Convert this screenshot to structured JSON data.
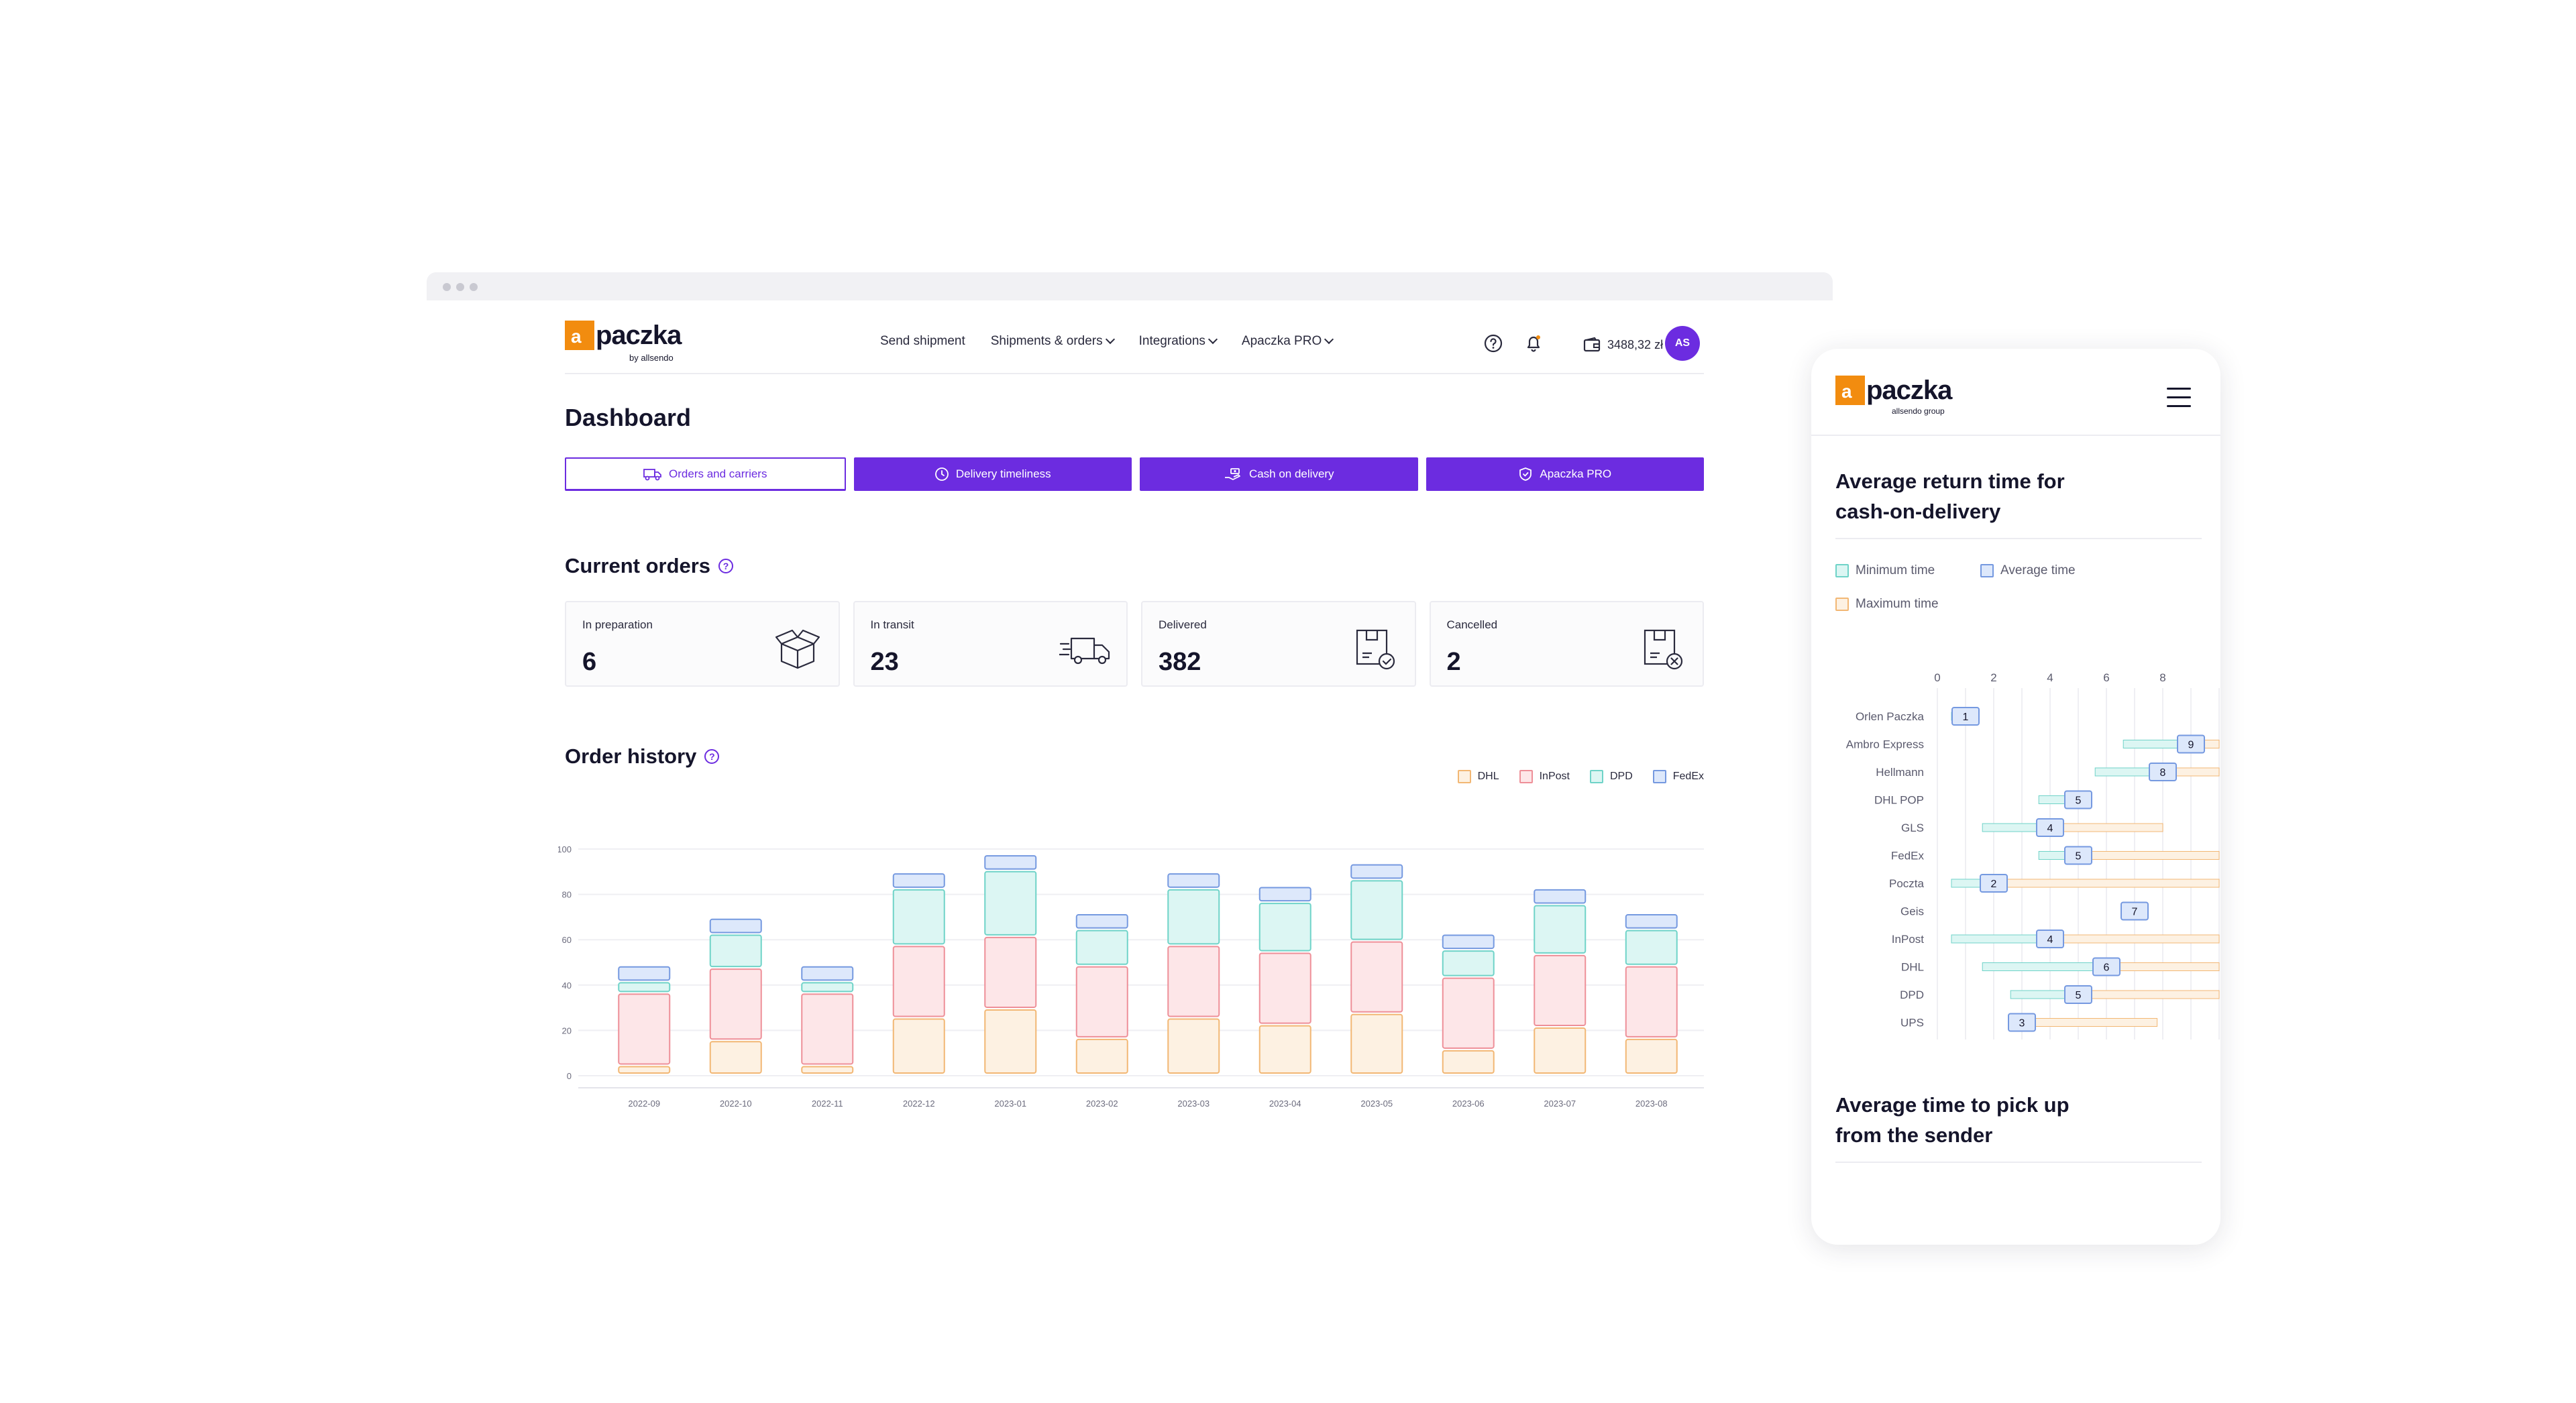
{
  "brand": {
    "logo_mark": "a",
    "logo_word": "paczka",
    "desktop_sub": "by allsendo",
    "mobile_sub": "allsendo group",
    "orange": "#f28c0f",
    "purple": "#6c2ce0"
  },
  "nav": {
    "items": [
      {
        "label": "Send shipment",
        "dropdown": false
      },
      {
        "label": "Shipments & orders",
        "dropdown": true
      },
      {
        "label": "Integrations",
        "dropdown": true
      },
      {
        "label": "Apaczka PRO",
        "dropdown": true
      }
    ],
    "help_icon": "help-circle-icon",
    "notification_icon": "bell-icon",
    "wallet_icon": "wallet-icon",
    "balance": "3488,32 zł",
    "avatar_initials": "AS"
  },
  "page": {
    "title": "Dashboard"
  },
  "tabs": [
    {
      "label": "Orders and carriers",
      "icon": "truck-icon",
      "active": true
    },
    {
      "label": "Delivery timeliness",
      "icon": "clock-icon",
      "active": false
    },
    {
      "label": "Cash on delivery",
      "icon": "hand-cash-icon",
      "active": false
    },
    {
      "label": "Apaczka PRO",
      "icon": "shield-icon",
      "active": false
    }
  ],
  "current_orders": {
    "title": "Current orders",
    "help_mark": "?",
    "cards": [
      {
        "label": "In preparation",
        "value": "6",
        "icon": "open-box-icon"
      },
      {
        "label": "In transit",
        "value": "23",
        "icon": "delivery-truck-icon"
      },
      {
        "label": "Delivered",
        "value": "382",
        "icon": "box-check-icon"
      },
      {
        "label": "Cancelled",
        "value": "2",
        "icon": "box-cancel-icon"
      }
    ]
  },
  "order_history": {
    "title": "Order history",
    "help_mark": "?",
    "legend": [
      {
        "name": "DHL",
        "fill": "#fdf1e2",
        "stroke": "#f2b774"
      },
      {
        "name": "InPost",
        "fill": "#fde6e8",
        "stroke": "#ee8f98"
      },
      {
        "name": "DPD",
        "fill": "#dcf6f3",
        "stroke": "#6fd3c8"
      },
      {
        "name": "FedEx",
        "fill": "#dde8fb",
        "stroke": "#7599e0"
      }
    ]
  },
  "chart_data": [
    {
      "type": "bar",
      "stacked": true,
      "title": "Order history",
      "categories": [
        "2022-09",
        "2022-10",
        "2022-11",
        "2022-12",
        "2023-01",
        "2023-02",
        "2023-03",
        "2023-04",
        "2023-05",
        "2023-06",
        "2023-07",
        "2023-08"
      ],
      "series": [
        {
          "name": "DHL",
          "values": [
            4,
            15,
            4,
            25,
            29,
            16,
            25,
            22,
            27,
            11,
            21,
            16
          ]
        },
        {
          "name": "InPost",
          "values": [
            32,
            32,
            32,
            32,
            32,
            32,
            32,
            32,
            32,
            32,
            32,
            32
          ]
        },
        {
          "name": "DPD",
          "values": [
            5,
            15,
            5,
            25,
            29,
            16,
            25,
            22,
            27,
            12,
            22,
            16
          ]
        },
        {
          "name": "FedEx",
          "values": [
            7,
            7,
            7,
            7,
            7,
            7,
            7,
            7,
            7,
            7,
            7,
            7
          ]
        }
      ],
      "ylim": [
        0,
        100
      ],
      "yticks": [
        0,
        20,
        40,
        60,
        80,
        100
      ],
      "grid": true,
      "legend_position": "top-right"
    },
    {
      "type": "bar",
      "orientation": "horizontal",
      "title": "Average return time for cash-on-delivery",
      "categories": [
        "Orlen Paczka",
        "Ambro Express",
        "Hellmann",
        "DHL POP",
        "GLS",
        "FedEx",
        "Poczta",
        "Geis",
        "InPost",
        "DHL",
        "DPD",
        "UPS"
      ],
      "series": [
        {
          "name": "Minimum time",
          "fill": "#dcf6f3",
          "stroke": "#6fd3c8",
          "values": [
            0.5,
            6.6,
            5.6,
            3.6,
            1.6,
            3.6,
            0.5,
            6.6,
            0.5,
            1.6,
            2.6,
            2.6
          ]
        },
        {
          "name": "Average time",
          "fill": "#dde8fb",
          "stroke": "#7599e0",
          "values": [
            1,
            9,
            8,
            5,
            4,
            5,
            2,
            7,
            4,
            6,
            5,
            3
          ]
        },
        {
          "name": "Maximum time",
          "fill": "#fdf1e2",
          "stroke": "#f2b774",
          "values": [
            null,
            10,
            10,
            null,
            8,
            10,
            10,
            null,
            10,
            10,
            10,
            7.8
          ]
        }
      ],
      "xticks": [
        0,
        2,
        4,
        6,
        8
      ],
      "xlim": [
        0,
        10
      ],
      "grid": true
    }
  ],
  "mobile": {
    "menu_icon": "hamburger-icon",
    "section1_title_line1": "Average return time for",
    "section1_title_line2": "cash-on-delivery",
    "legend": [
      {
        "name": "Minimum time"
      },
      {
        "name": "Average time"
      },
      {
        "name": "Maximum time"
      }
    ],
    "section2_title_line1": "Average time to pick up",
    "section2_title_line2": "from the sender"
  }
}
